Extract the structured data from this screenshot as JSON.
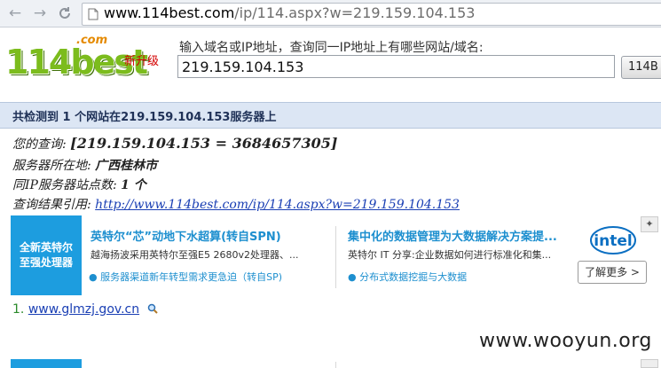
{
  "browser": {
    "url_host": "www.114best.com",
    "url_rest": "/ip/114.aspx?w=219.159.104.153",
    "icons": [
      "back-icon",
      "forward-icon",
      "reload-icon",
      "page-icon"
    ]
  },
  "header": {
    "logo_main": "114best",
    "logo_com": ".com",
    "upgrade_badge": "新升级",
    "prompt": "输入域名或IP地址，查询同一IP地址上有哪些网站/域名:",
    "query_value": "219.159.104.153",
    "query_button": "114B"
  },
  "result": {
    "title": "共检测到 1 个网站在219.159.104.153服务器上",
    "query_label": "您的查询: ",
    "query_text": "[219.159.104.153 = 3684657305]",
    "location_label": "服务器所在地: ",
    "location_value": "广西桂林市",
    "count_label": "同IP服务器站点数: ",
    "count_value": "1 个",
    "cite_label": "查询结果引用: ",
    "cite_link": "http://www.114best.com/ip/114.aspx?w=219.159.104.153",
    "sites": [
      {
        "num": "1.",
        "domain": "www.glmzj.gov.cn",
        "icon": "magnifier-icon"
      }
    ]
  },
  "ad": {
    "side_line1": "全新英特尔",
    "side_line2": "至强处理器",
    "left": {
      "title": "英特尔“芯”动地下水超算(转自SPN)",
      "desc": "越海扬波采用英特尔至强E5 2680v2处理器、...",
      "link": "服务器渠道新年转型需求更急迫（转自SP)"
    },
    "right": {
      "title": "集中化的数据管理为大数据解决方案提...",
      "desc": "英特尔 IT 分享:企业数据如何进行标准化和集...",
      "link": "分布式数据挖掘与大数据"
    },
    "intel_logo": "intel",
    "more_button": "了解更多 >",
    "colors": {
      "accent": "#1d9ddf",
      "title": "#1d8fcf"
    }
  },
  "watermark": "www.wooyun.org"
}
